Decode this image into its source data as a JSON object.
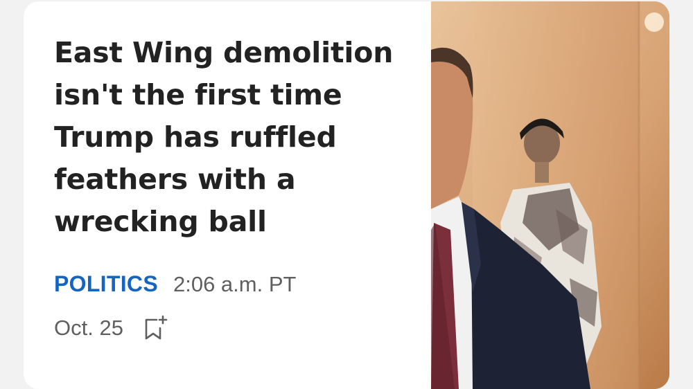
{
  "article": {
    "headline": "East Wing demolition isn't the first time Trump has ruffled feathers with a wrecking ball",
    "category": "POLITICS",
    "time": "2:06 a.m. PT",
    "date": "Oct. 25"
  },
  "icons": {
    "bookmark": "bookmark-add-icon"
  },
  "colors": {
    "category": "#1565c0",
    "headline": "#222222",
    "meta": "#5f5f5f"
  }
}
